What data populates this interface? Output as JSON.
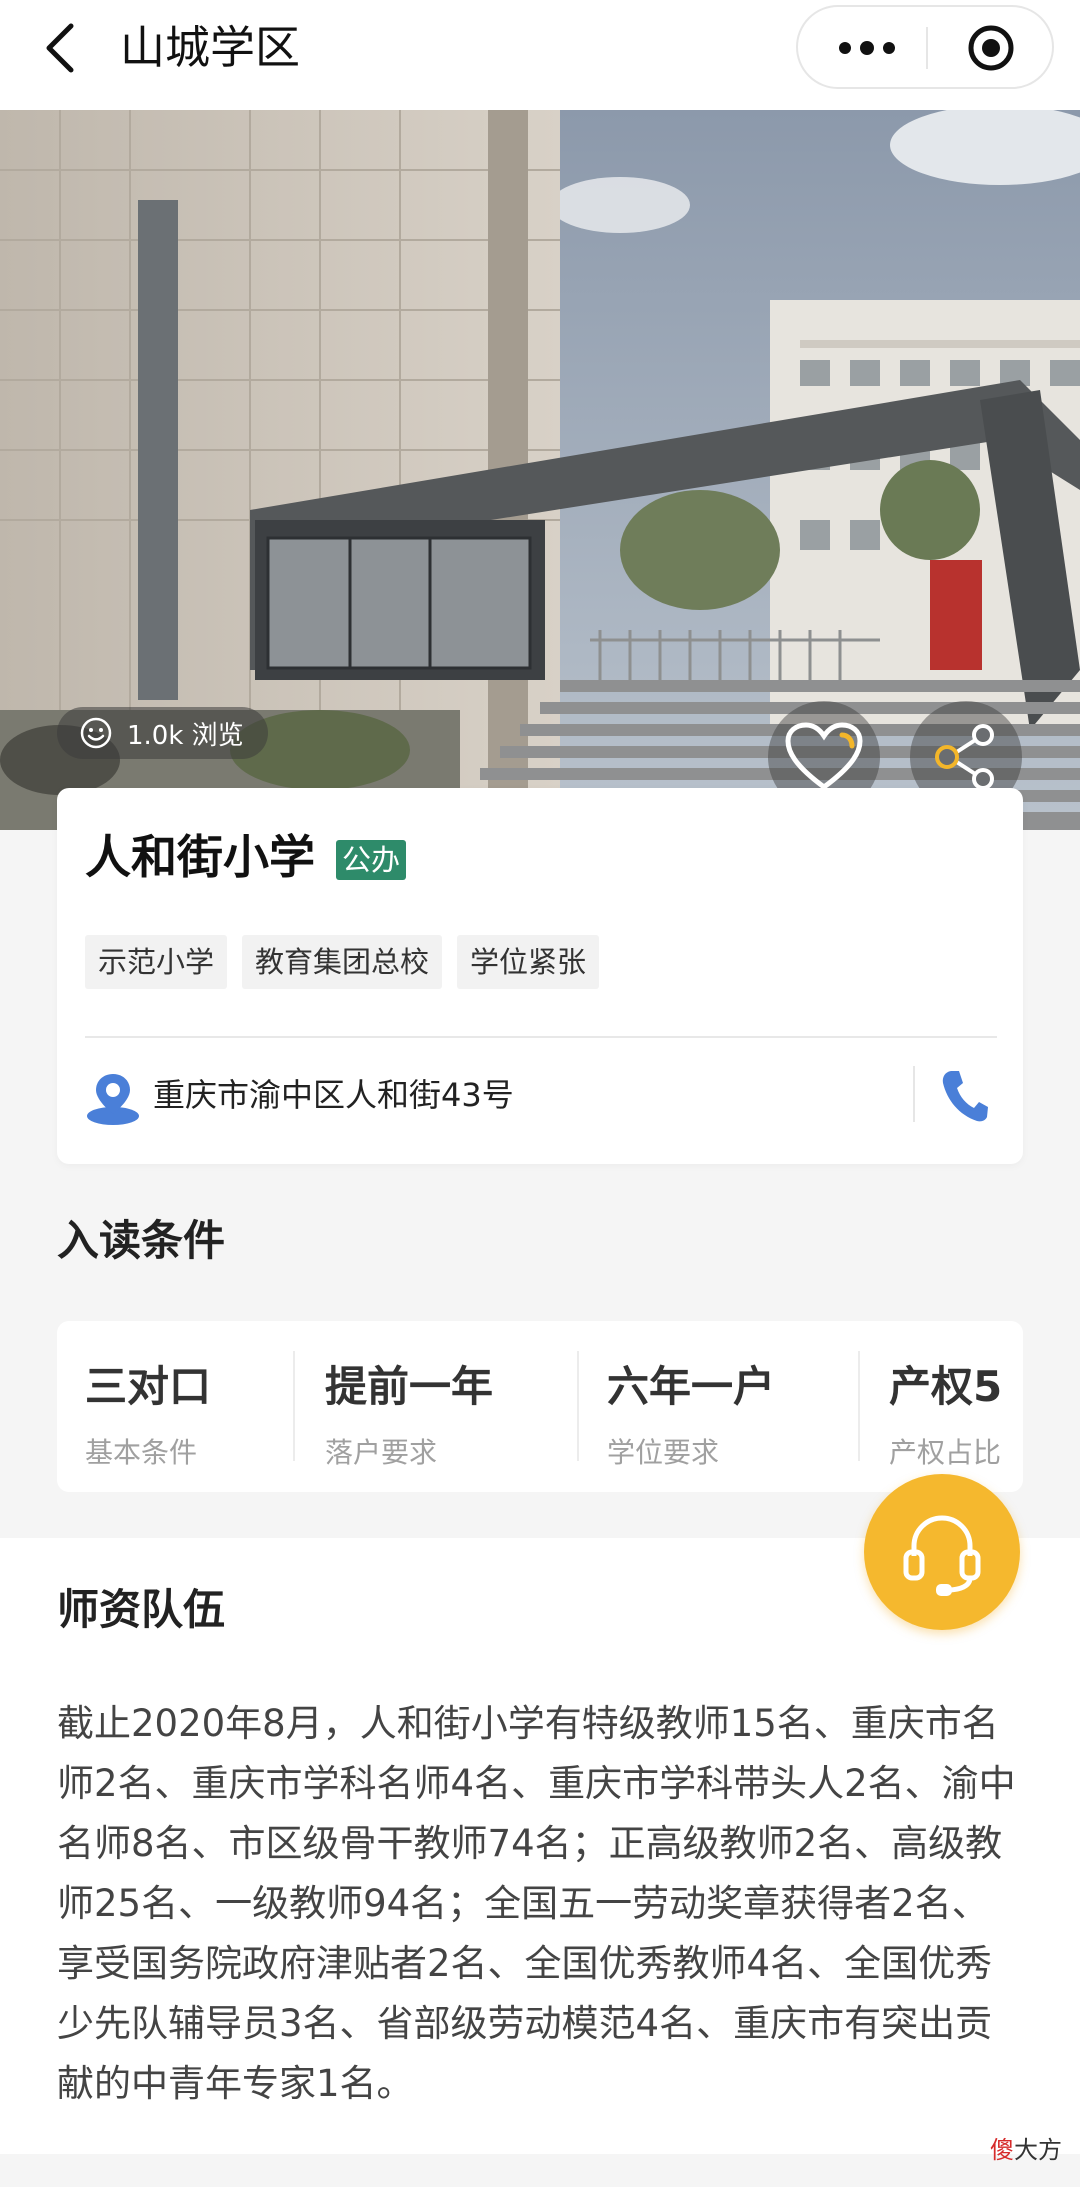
{
  "nav": {
    "title": "山城学区",
    "back_icon": "chevron-left-icon",
    "more_icon": "more-dots-icon",
    "target_icon": "record-target-icon"
  },
  "hero": {
    "image_desc": "school-gate-photo",
    "views_text": "1.0k 浏览",
    "favorite_icon": "heart-icon",
    "share_icon": "share-icon"
  },
  "school": {
    "name": "人和街小学",
    "type_badge": "公办",
    "badge_color": "#2e8b6a",
    "tags": [
      "示范小学",
      "教育集团总校",
      "学位紧张"
    ],
    "address": "重庆市渝中区人和街43号"
  },
  "enrollment": {
    "title": "入读条件",
    "items": [
      {
        "main": "三对口",
        "sub": "基本条件"
      },
      {
        "main": "提前一年",
        "sub": "落户要求"
      },
      {
        "main": "六年一户",
        "sub": "学位要求"
      },
      {
        "main": "产权5",
        "sub": "产权占比"
      }
    ]
  },
  "teachers": {
    "title": "师资队伍",
    "body": "截止2020年8月，人和街小学有特级教师15名、重庆市名师2名、重庆市学科名师4名、重庆市学科带头人2名、渝中名师8名、市区级骨干教师74名；正高级教师2名、高级教师25名、一级教师94名；全国五一劳动奖章获得者2名、享受国务院政府津贴者2名、全国优秀教师4名、全国优秀少先队辅导员3名、省部级劳动模范4名、重庆市有突出贡献的中青年专家1名。"
  },
  "watermark": {
    "red": "傻",
    "rest": "大方"
  },
  "colors": {
    "accent_blue": "#4a7fd8",
    "support_yellow": "#f5b82e"
  }
}
